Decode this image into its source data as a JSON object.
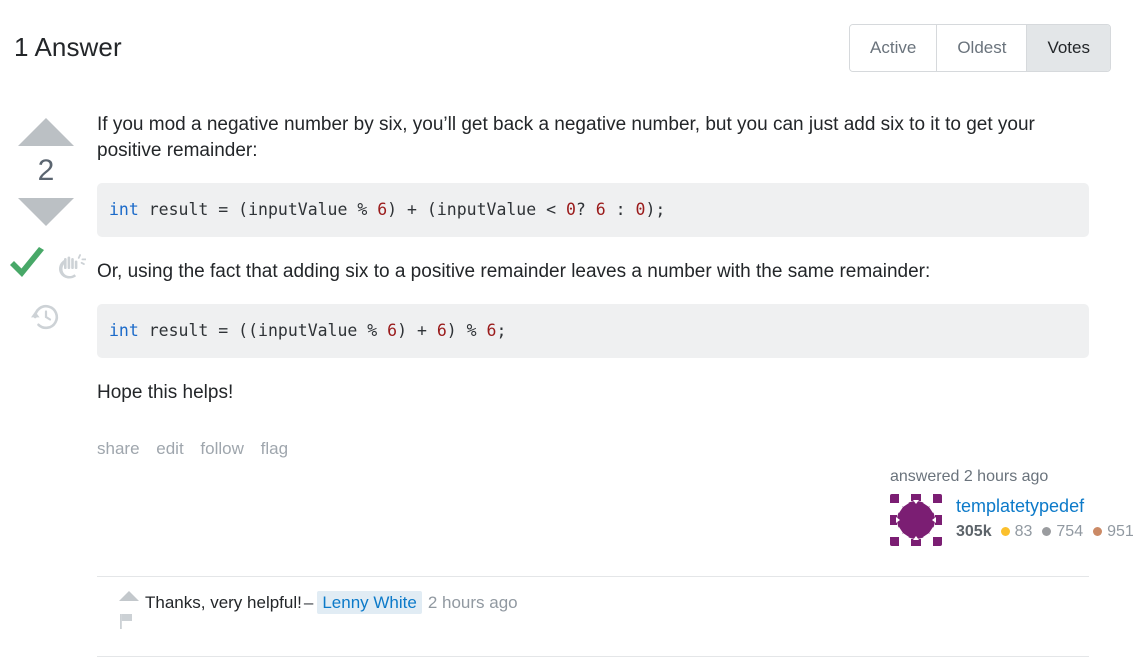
{
  "header": {
    "answers_title": "1 Answer",
    "sort_tabs": [
      {
        "label": "Active",
        "selected": false
      },
      {
        "label": "Oldest",
        "selected": false
      },
      {
        "label": "Votes",
        "selected": true
      }
    ]
  },
  "answer": {
    "vote_count": "2",
    "is_accepted": true,
    "icons": {
      "upvote": "triangle-up-icon",
      "downvote": "triangle-down-icon",
      "accepted": "checkmark-icon",
      "bounty": "snap-fingers-icon",
      "history": "clock-history-icon"
    },
    "paragraphs": {
      "p1": "If you mod a negative number by six, you’ll get back a negative number, but you can just add six to it to get your positive remainder:",
      "p2": "Or, using the fact that adding six to a positive remainder leaves a number with the same remainder:",
      "p3": "Hope this helps!"
    },
    "code_1": {
      "tokens": [
        {
          "t": "int",
          "c": "kw"
        },
        {
          "t": " result = (inputValue % ",
          "c": ""
        },
        {
          "t": "6",
          "c": "num"
        },
        {
          "t": ") + (inputValue < ",
          "c": ""
        },
        {
          "t": "0",
          "c": "num"
        },
        {
          "t": "? ",
          "c": ""
        },
        {
          "t": "6",
          "c": "num"
        },
        {
          "t": " : ",
          "c": ""
        },
        {
          "t": "0",
          "c": "num"
        },
        {
          "t": ");",
          "c": ""
        }
      ],
      "plain": "int result = (inputValue % 6) + (inputValue < 0? 6 : 0);"
    },
    "code_2": {
      "tokens": [
        {
          "t": "int",
          "c": "kw"
        },
        {
          "t": " result = ((inputValue % ",
          "c": ""
        },
        {
          "t": "6",
          "c": "num"
        },
        {
          "t": ") + ",
          "c": ""
        },
        {
          "t": "6",
          "c": "num"
        },
        {
          "t": ") % ",
          "c": ""
        },
        {
          "t": "6",
          "c": "num"
        },
        {
          "t": ";",
          "c": ""
        }
      ],
      "plain": "int result = ((inputValue % 6) + 6) % 6;"
    },
    "actions": [
      {
        "label": "share"
      },
      {
        "label": "edit"
      },
      {
        "label": "follow"
      },
      {
        "label": "flag"
      }
    ],
    "user_card": {
      "answered_time": "answered 2 hours ago",
      "user_name": "templatetypedef",
      "reputation": "305k",
      "badges": [
        {
          "tier": "gold",
          "count": "83"
        },
        {
          "tier": "silver",
          "count": "754"
        },
        {
          "tier": "bronze",
          "count": "951"
        }
      ],
      "avatar": "identicon-avatar"
    }
  },
  "comments": [
    {
      "text": "Thanks, very helpful!",
      "dash": "–",
      "author": "Lenny White",
      "time": "2 hours ago",
      "upvote_icon": "triangle-up-icon",
      "flag_icon": "flag-icon"
    }
  ],
  "colors": {
    "accent_link": "#0c7ac9",
    "accepted_green": "#48a868",
    "code_keyword": "#1b6ac9",
    "code_number": "#9a1b1b",
    "code_bg": "#eff0f1",
    "gold": "#fbc02d",
    "silver": "#9a9c9f",
    "bronze": "#cb8a66",
    "tab_selected_bg": "#e3e6e8"
  }
}
